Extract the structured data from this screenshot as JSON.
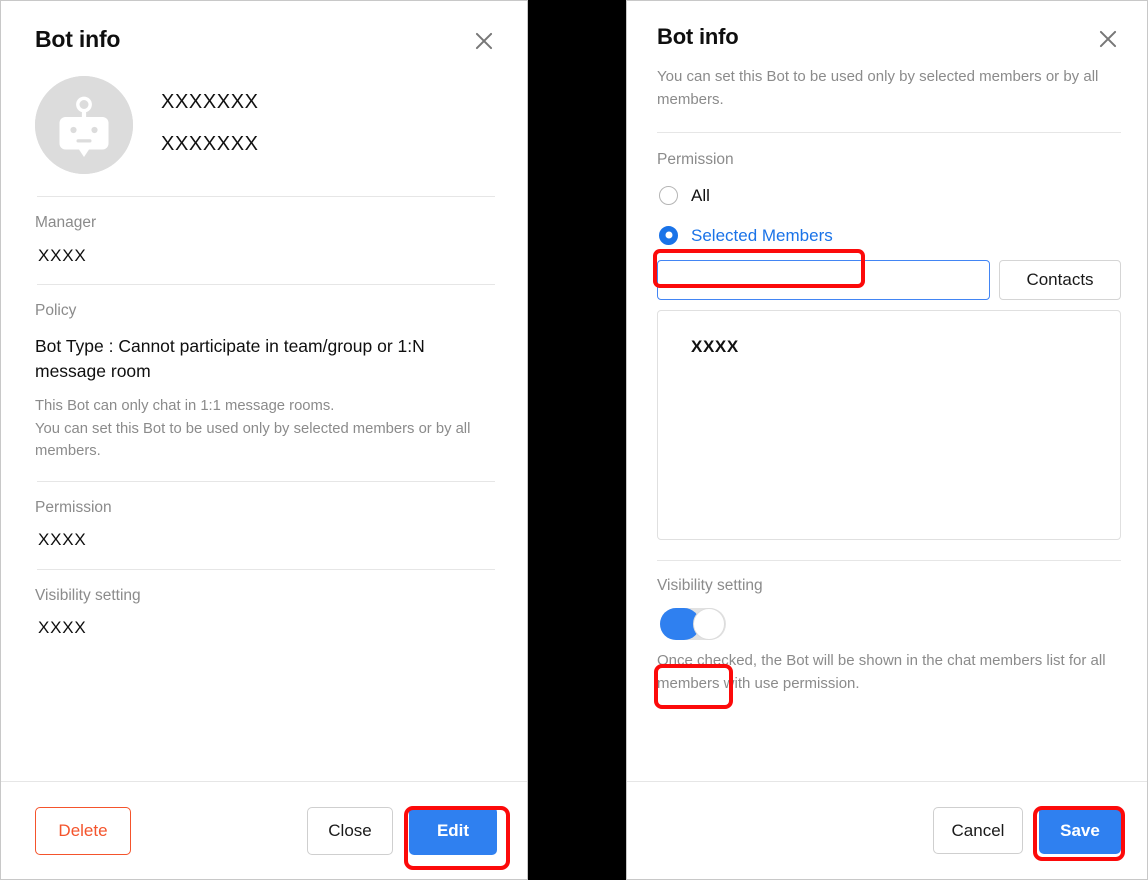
{
  "left_panel": {
    "title": "Bot info",
    "close_icon": "close-icon",
    "avatar_icon": "bot-avatar-icon",
    "bot_name_line_1": "XXXXXXX",
    "bot_name_line_2": "XXXXXXX",
    "fields": {
      "manager_label": "Manager",
      "manager_value": "XXXX",
      "policy_label": "Policy",
      "policy_heading": "Bot Type : Cannot participate in team/group or 1:N message room",
      "policy_note_line_1": "This Bot can only chat in 1:1 message rooms.",
      "policy_note_line_2": "You can set this Bot to be used only by selected members or by all members.",
      "permission_label": "Permission",
      "permission_value": "XXXX",
      "visibility_label": "Visibility setting",
      "visibility_value": "XXXX"
    },
    "footer": {
      "delete_label": "Delete",
      "close_label": "Close",
      "edit_label": "Edit"
    }
  },
  "right_panel": {
    "title": "Bot info",
    "close_icon": "close-icon",
    "intro": "You can set this Bot to be used only by selected members or by all members.",
    "permission_label": "Permission",
    "radios": [
      {
        "label": "All",
        "selected": false
      },
      {
        "label": "Selected Members",
        "selected": true
      }
    ],
    "member_input_value": "",
    "member_input_placeholder": "",
    "contacts_label": "Contacts",
    "member_list": [
      "XXXX"
    ],
    "visibility_label": "Visibility setting",
    "visibility_toggle_on": true,
    "visibility_note": "Once checked, the Bot will be shown in the chat members list for all members with use permission.",
    "footer": {
      "cancel_label": "Cancel",
      "save_label": "Save"
    }
  },
  "highlights": {
    "edit": "edit-button-highlight",
    "selected_members": "selected-members-highlight",
    "toggle": "visibility-toggle-highlight",
    "save": "save-button-highlight"
  },
  "colors": {
    "primary_blue": "#2f80f0",
    "radio_blue": "#1a73e8",
    "delete_orange": "#f4542c",
    "highlight_red": "#fc0a0a",
    "muted_grey": "#8b8b8b"
  }
}
